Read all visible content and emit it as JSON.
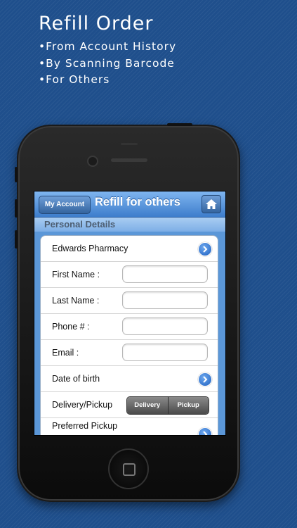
{
  "promo": {
    "title": "Refill Order",
    "bullets": [
      "•From Account History",
      "•By Scanning Barcode",
      "•For Others"
    ]
  },
  "nav": {
    "back_label": "My Account",
    "title": "Refill for others",
    "home_icon": "home-icon"
  },
  "section": {
    "title": "Personal Details"
  },
  "form": {
    "pharmacy": "Edwards Pharmacy",
    "first_name_label": "First Name :",
    "last_name_label": "Last Name :",
    "phone_label": "Phone # :",
    "email_label": "Email :",
    "dob_label": "Date of birth",
    "delivery_label": "Delivery/Pickup",
    "delivery_option": "Delivery",
    "pickup_option": "Pickup",
    "preferred_label": "Preferred Pickup"
  },
  "colors": {
    "background": "#1f4f8c",
    "navbar": "#3d7dcc",
    "disclosure": "#1d5fbf"
  }
}
